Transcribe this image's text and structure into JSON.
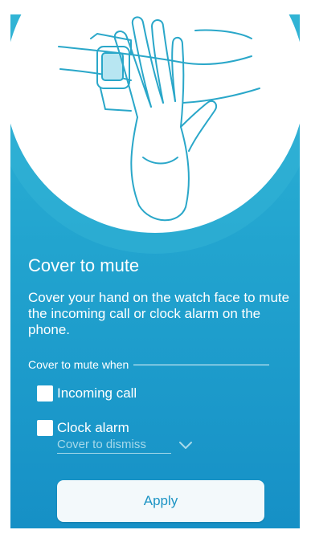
{
  "colors": {
    "background_top": "#2fb5d6",
    "background_bottom": "#1690c6",
    "illustration_circle": "#ffffff",
    "line_art": "#2aa7c9",
    "button_text": "#1c94c4",
    "dropdown_text": "#a6d9ea"
  },
  "illustration": {
    "icon": "hand-covering-watch-icon"
  },
  "header": {
    "title": "Cover to mute"
  },
  "description": "Cover your hand on the watch face to mute the incoming call or clock alarm on the phone.",
  "section": {
    "label": "Cover to mute when"
  },
  "options": [
    {
      "label": "Incoming call",
      "checked": false
    },
    {
      "label": "Clock alarm",
      "checked": false
    }
  ],
  "clock_alarm_action": {
    "value": "Cover to dismiss",
    "icon": "chevron-down-icon"
  },
  "apply_button": {
    "label": "Apply"
  }
}
